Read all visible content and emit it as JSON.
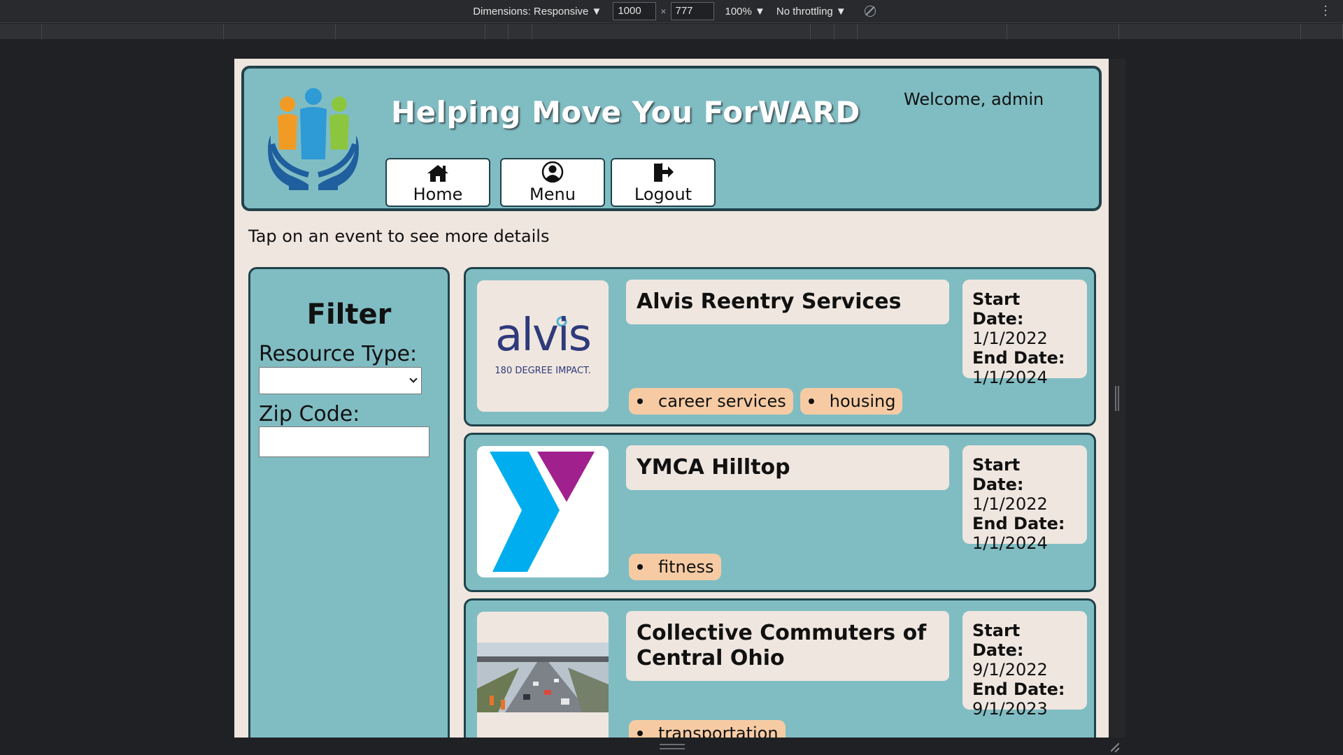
{
  "devtools": {
    "dimensions_label": "Dimensions: Responsive ▼",
    "width": "1000",
    "x_symbol": "×",
    "height": "777",
    "zoom": "100% ▼",
    "throttling": "No throttling ▼",
    "more": "⋮"
  },
  "header": {
    "title": "Helping Move You ForWARD",
    "welcome": "Welcome, admin",
    "nav": {
      "home": "Home",
      "menu": "Menu",
      "logout": "Logout"
    }
  },
  "hint": "Tap on an event to see more details",
  "filter": {
    "title": "Filter",
    "resource_type_label": "Resource Type:",
    "resource_type_value": "",
    "zip_label": "Zip Code:",
    "zip_value": ""
  },
  "date_labels": {
    "start": "Start Date:",
    "end": "End Date:"
  },
  "events": [
    {
      "name": "Alvis Reentry Services",
      "start": "1/1/2022",
      "end": "1/1/2024",
      "tags": [
        "career services",
        "housing"
      ],
      "logo_text": "alvis",
      "logo_subtext": "180 DEGREE IMPACT."
    },
    {
      "name": "YMCA Hilltop",
      "start": "1/1/2022",
      "end": "1/1/2024",
      "tags": [
        "fitness"
      ]
    },
    {
      "name": "Collective Commuters of Central Ohio",
      "start": "9/1/2022",
      "end": "9/1/2023",
      "tags": [
        "transportation"
      ]
    }
  ],
  "colors": {
    "page_bg": "#efe6df",
    "panel_teal": "#80bdc3",
    "border_dark": "#20424a",
    "tag_bg": "#f6cba3"
  }
}
